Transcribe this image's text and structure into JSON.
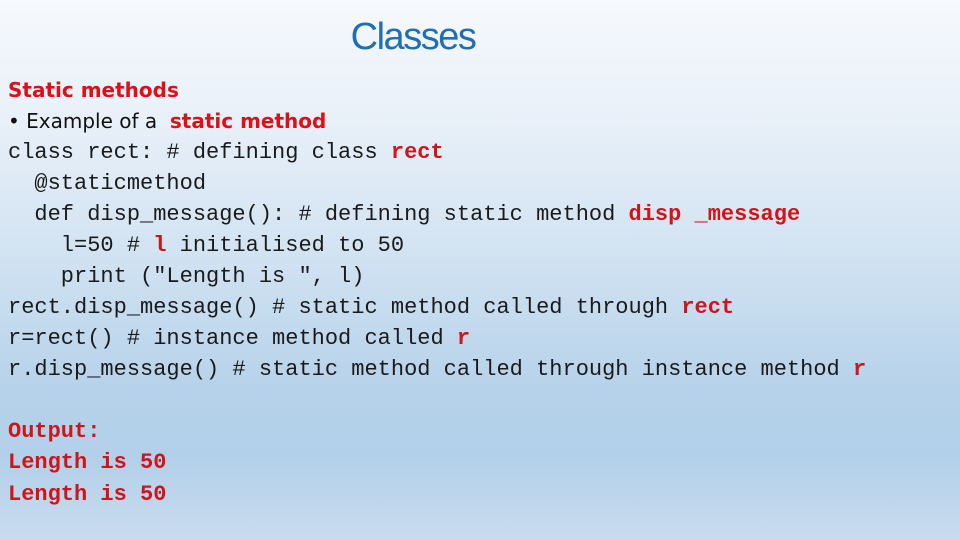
{
  "slide": {
    "title": "Classes",
    "heading": "Static methods",
    "bullet": {
      "marker": "•",
      "text": " Example of a  ",
      "highlight": "static method"
    },
    "code_lines": [
      {
        "text": "class rect: # defining class ",
        "highlight": "rect"
      },
      {
        "text": "  @staticmethod",
        "highlight": ""
      },
      {
        "text": "  def disp_message(): # defining static method ",
        "highlight": "disp _message"
      },
      {
        "text": "    l=50 # ",
        "highlight": "l",
        "suffix": " initialised to 50"
      },
      {
        "text": "    print (\"Length is \", l)",
        "highlight": ""
      },
      {
        "text": "rect.disp_message() # static method called through ",
        "highlight": "rect"
      },
      {
        "text": "r=rect() # instance method called ",
        "highlight": "r"
      },
      {
        "text": "r.disp_message() # static method called through instance method ",
        "highlight": "r"
      }
    ],
    "output": {
      "label": "Output:",
      "lines": [
        "Length is 50",
        "Length is 50"
      ]
    }
  },
  "colors": {
    "title": "#1f6fb6",
    "highlight": "#e00f16",
    "code_text": "#1a1a1a"
  }
}
